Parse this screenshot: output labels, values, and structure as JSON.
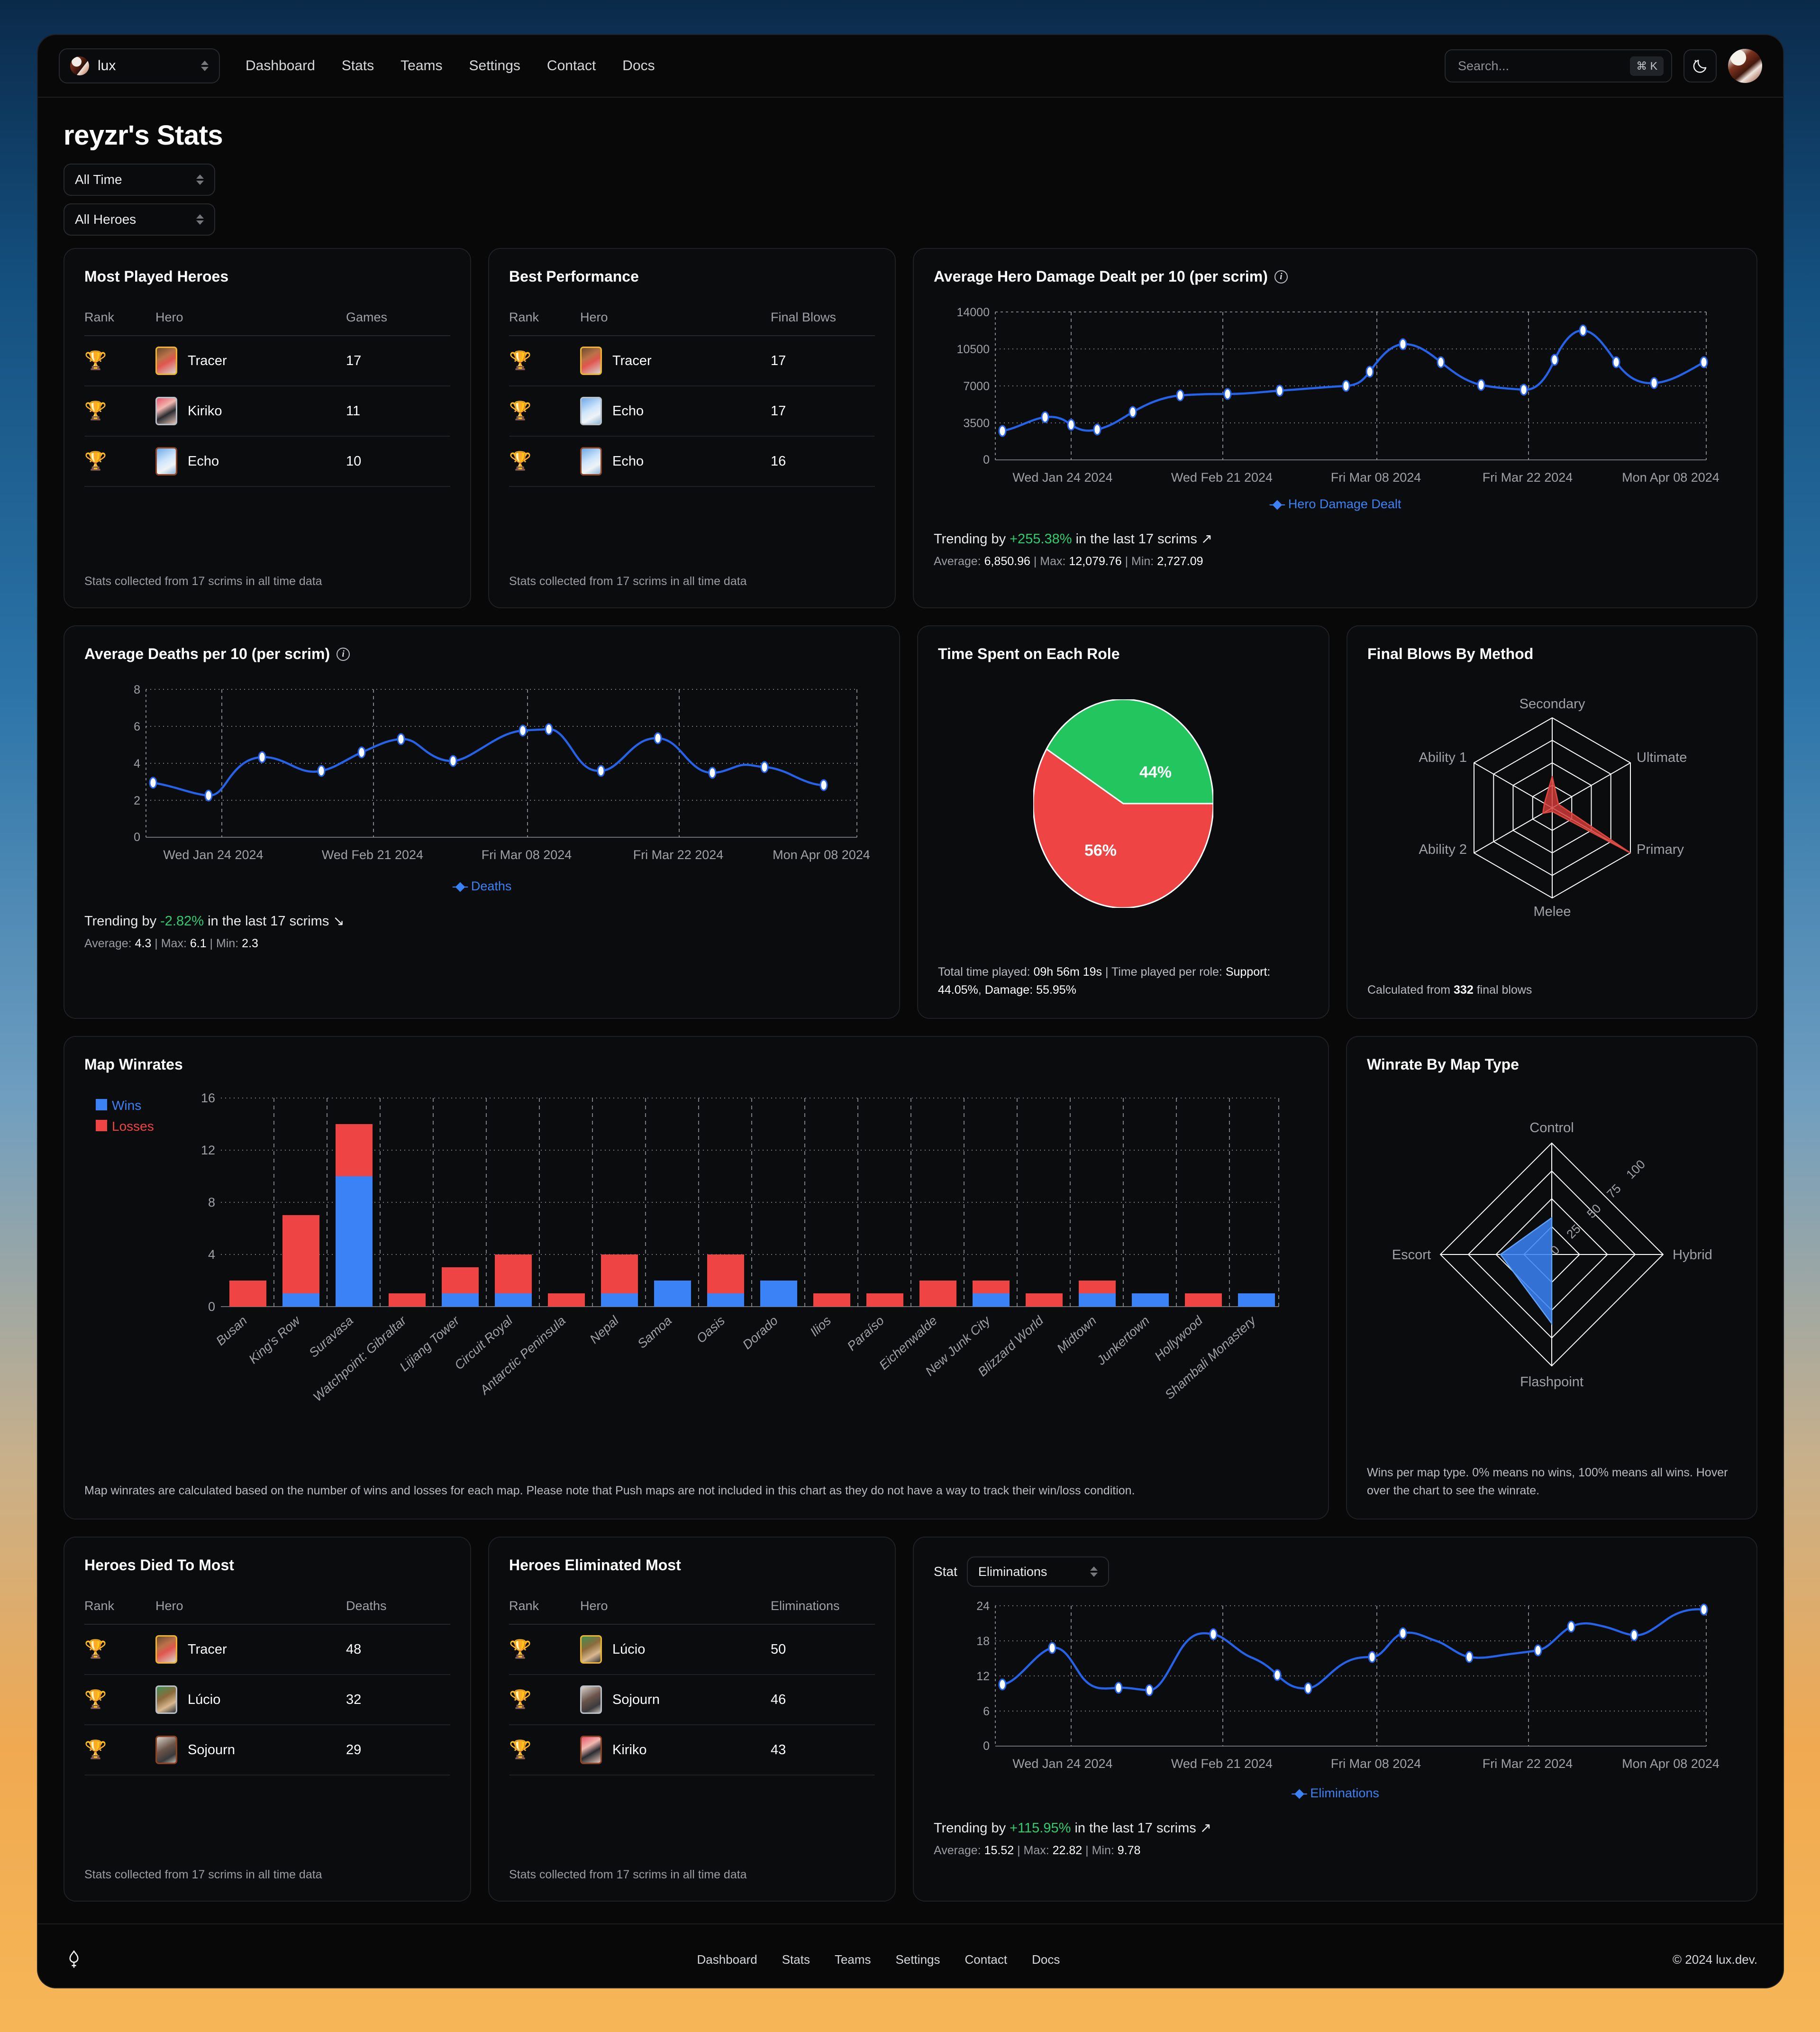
{
  "nav": {
    "org_name": "lux",
    "links": [
      "Dashboard",
      "Stats",
      "Teams",
      "Settings",
      "Contact",
      "Docs"
    ],
    "search_placeholder": "Search...",
    "search_value": "",
    "search_shortcut": "⌘ K"
  },
  "page": {
    "title": "reyzr's Stats",
    "filter_time": "All Time",
    "filter_hero": "All Heroes"
  },
  "most_played": {
    "title": "Most Played Heroes",
    "columns": [
      "Rank",
      "Hero",
      "Games"
    ],
    "rows": [
      {
        "rank": 1,
        "hero": "Tracer",
        "value": "17"
      },
      {
        "rank": 2,
        "hero": "Kiriko",
        "value": "11"
      },
      {
        "rank": 3,
        "hero": "Echo",
        "value": "10"
      }
    ],
    "footnote": "Stats collected from 17 scrims in all time data"
  },
  "best_performance": {
    "title": "Best Performance",
    "columns": [
      "Rank",
      "Hero",
      "Final Blows"
    ],
    "rows": [
      {
        "rank": 1,
        "hero": "Tracer",
        "value": "17"
      },
      {
        "rank": 2,
        "hero": "Echo",
        "value": "17"
      },
      {
        "rank": 3,
        "hero": "Echo",
        "value": "16"
      }
    ],
    "footnote": "Stats collected from 17 scrims in all time data"
  },
  "damage_card": {
    "title": "Average Hero Damage Dealt per 10 (per scrim)",
    "trend_prefix": "Trending by ",
    "trend_value": "+255.38%",
    "trend_suffix": " in the last 17 scrims ",
    "trend_arrow": "↗",
    "stats_average_label": "Average: ",
    "stats_average": "6,850.96",
    "stats_max_label": " | Max: ",
    "stats_max": "12,079.76",
    "stats_min_label": " | Min: ",
    "stats_min": "2,727.09"
  },
  "deaths_card": {
    "title": "Average Deaths per 10 (per scrim)",
    "trend_prefix": "Trending by ",
    "trend_value": "-2.82%",
    "trend_suffix": " in the last 17 scrims ",
    "trend_arrow": "↘",
    "stats_average_label": "Average: ",
    "stats_average": "4.3",
    "stats_max_label": " | Max: ",
    "stats_max": "6.1",
    "stats_min_label": " | Min: ",
    "stats_min": "2.3"
  },
  "role_card": {
    "title": "Time Spent on Each Role",
    "footnote_a": "Total time played: ",
    "total_time": "09h 56m 19s",
    "footnote_b": " | Time played per role: ",
    "support_label": "Support: 44.05%",
    "footnote_c": ", ",
    "damage_label": "Damage: 55.95%"
  },
  "final_blows_card": {
    "title": "Final Blows By Method",
    "footnote_a": "Calculated from ",
    "count": "332",
    "footnote_b": " final blows"
  },
  "map_winrates_card": {
    "title": "Map Winrates",
    "legend": [
      "Wins",
      "Losses"
    ],
    "note": "Map winrates are calculated based on the number of wins and losses for each map. Please note that Push maps are not included in this chart as they do not have a way to track their win/loss condition."
  },
  "winrate_type_card": {
    "title": "Winrate By Map Type",
    "note": "Wins per map type. 0% means no wins, 100% means all wins. Hover over the chart to see the winrate."
  },
  "died_to_card": {
    "title": "Heroes Died To Most",
    "columns": [
      "Rank",
      "Hero",
      "Deaths"
    ],
    "rows": [
      {
        "rank": 1,
        "hero": "Tracer",
        "value": "48"
      },
      {
        "rank": 2,
        "hero": "Lúcio",
        "value": "32"
      },
      {
        "rank": 3,
        "hero": "Sojourn",
        "value": "29"
      }
    ],
    "footnote": "Stats collected from 17 scrims in all time data"
  },
  "eliminated_card": {
    "title": "Heroes Eliminated Most",
    "columns": [
      "Rank",
      "Hero",
      "Eliminations"
    ],
    "rows": [
      {
        "rank": 1,
        "hero": "Lúcio",
        "value": "50"
      },
      {
        "rank": 2,
        "hero": "Sojourn",
        "value": "46"
      },
      {
        "rank": 3,
        "hero": "Kiriko",
        "value": "43"
      }
    ],
    "footnote": "Stats collected from 17 scrims in all time data"
  },
  "elims_card": {
    "stat_label": "Stat",
    "stat_selected": "Eliminations",
    "trend_prefix": "Trending by ",
    "trend_value": "+115.95%",
    "trend_suffix": " in the last 17 scrims ",
    "trend_arrow": "↗",
    "stats_average_label": "Average: ",
    "stats_average": "15.52",
    "stats_max_label": " | Max: ",
    "stats_max": "22.82",
    "stats_min_label": " | Min: ",
    "stats_min": "9.78"
  },
  "footer": {
    "links": [
      "Dashboard",
      "Stats",
      "Teams",
      "Settings",
      "Contact",
      "Docs"
    ],
    "copyright": "© 2024 lux.dev."
  },
  "colors": {
    "accent_blue": "#3b82f6",
    "loss_red": "#ef4444",
    "win_blue": "#3b82f6",
    "support_green": "#22c55e",
    "damage_red": "#ef4444",
    "trend_green": "#2ecc71",
    "radar_red": "#d23b37",
    "gold": "#f0b429",
    "silver": "#c7ccd1",
    "bronze": "#a34b1c"
  },
  "chart_data": [
    {
      "type": "line",
      "name": "hero-damage-dealt",
      "title": "Average Hero Damage Dealt per 10 (per scrim)",
      "legend": "Hero Damage Dealt",
      "legend_position": "bottom-center",
      "xlabel": "",
      "ylabel": "",
      "ylim": [
        0,
        14000
      ],
      "yticks": [
        0,
        3500,
        7000,
        10500,
        14000
      ],
      "grid": true,
      "xtick_labels": [
        "Wed Jan 24 2024",
        "Wed Feb 21 2024",
        "Fri Mar 08 2024",
        "Fri Mar 22 2024",
        "Mon Apr 08 2024"
      ],
      "values": [
        2727.09,
        4400,
        3350,
        4600,
        6050,
        6040,
        6300,
        6950,
        10250,
        8650,
        7300,
        12079.76,
        7650,
        9750
      ],
      "series_color": "#2563eb"
    },
    {
      "type": "line",
      "name": "average-deaths",
      "title": "Average Deaths per 10 (per scrim)",
      "legend": "Deaths",
      "legend_position": "bottom-center",
      "xlabel": "",
      "ylabel": "",
      "ylim": [
        0,
        8
      ],
      "yticks": [
        0,
        2,
        4,
        6,
        8
      ],
      "grid": true,
      "xtick_labels": [
        "Wed Jan 24 2024",
        "Wed Feb 21 2024",
        "Fri Mar 08 2024",
        "Fri Mar 22 2024",
        "Mon Apr 08 2024"
      ],
      "values": [
        2.95,
        2.3,
        4.3,
        3.75,
        4.65,
        5.45,
        4.7,
        5.9,
        6.1,
        3.85,
        5.55,
        3.65,
        4.15,
        2.8
      ],
      "series_color": "#2563eb"
    },
    {
      "type": "pie",
      "name": "time-spent-on-each-role",
      "title": "Time Spent on Each Role",
      "labels": [
        "Support",
        "Damage"
      ],
      "values": [
        44,
        56
      ],
      "display_labels": [
        "44%",
        "56%"
      ],
      "colors": [
        "#22c55e",
        "#ef4444"
      ]
    },
    {
      "type": "radar",
      "name": "final-blows-by-method",
      "title": "Final Blows By Method",
      "categories": [
        "Secondary",
        "Ultimate",
        "Primary",
        "Melee",
        "Ability 2",
        "Ability 1"
      ],
      "values": [
        35,
        8,
        100,
        4,
        12,
        10
      ],
      "rings": 4,
      "max": 100,
      "fill_color": "#d23b37"
    },
    {
      "type": "bar",
      "name": "map-winrates",
      "title": "Map Winrates",
      "stacked": true,
      "ylim": [
        0,
        16
      ],
      "yticks": [
        0,
        4,
        8,
        12,
        16
      ],
      "grid": true,
      "categories": [
        "Busan",
        "King's Row",
        "Suravasa",
        "Watchpoint: Gibraltar",
        "Lijiang Tower",
        "Circuit Royal",
        "Antarctic Peninsula",
        "Nepal",
        "Samoa",
        "Oasis",
        "Dorado",
        "Ilios",
        "Paraíso",
        "Eichenwalde",
        "New Junk City",
        "Blizzard World",
        "Midtown",
        "Junkertown",
        "Hollywood",
        "Shambali Monastery"
      ],
      "series": [
        {
          "name": "Wins",
          "color": "#3b82f6",
          "values": [
            0,
            1,
            10,
            0,
            1,
            1,
            0,
            1,
            2,
            1,
            2,
            0,
            0,
            0,
            1,
            0,
            1,
            1,
            0,
            1
          ]
        },
        {
          "name": "Losses",
          "color": "#ef4444",
          "values": [
            2,
            6,
            4,
            1,
            2,
            3,
            1,
            3,
            0,
            3,
            0,
            1,
            1,
            2,
            1,
            1,
            1,
            0,
            1,
            0
          ]
        }
      ]
    },
    {
      "type": "radar",
      "name": "winrate-by-map-type",
      "title": "Winrate By Map Type",
      "categories": [
        "Control",
        "Hybrid",
        "Flashpoint",
        "Escort"
      ],
      "values": [
        33,
        0,
        62,
        46
      ],
      "rings": 4,
      "max": 100,
      "scale_labels": [
        "0",
        "25",
        "50",
        "75",
        "100"
      ],
      "fill_color": "#3b82f6"
    },
    {
      "type": "line",
      "name": "eliminations",
      "title": "Eliminations",
      "legend": "Eliminations",
      "legend_position": "bottom-center",
      "xlabel": "",
      "ylabel": "",
      "ylim": [
        0,
        24
      ],
      "yticks": [
        0,
        6,
        12,
        18,
        24
      ],
      "grid": true,
      "xtick_labels": [
        "Wed Jan 24 2024",
        "Wed Feb 21 2024",
        "Fri Mar 08 2024",
        "Fri Mar 22 2024",
        "Mon Apr 08 2024"
      ],
      "values": [
        10.5,
        16.8,
        10.0,
        9.78,
        17.7,
        14.8,
        10.4,
        14.9,
        18.2,
        16.4,
        16.8,
        19.5,
        18.4,
        22.82
      ],
      "series_color": "#2563eb"
    }
  ]
}
